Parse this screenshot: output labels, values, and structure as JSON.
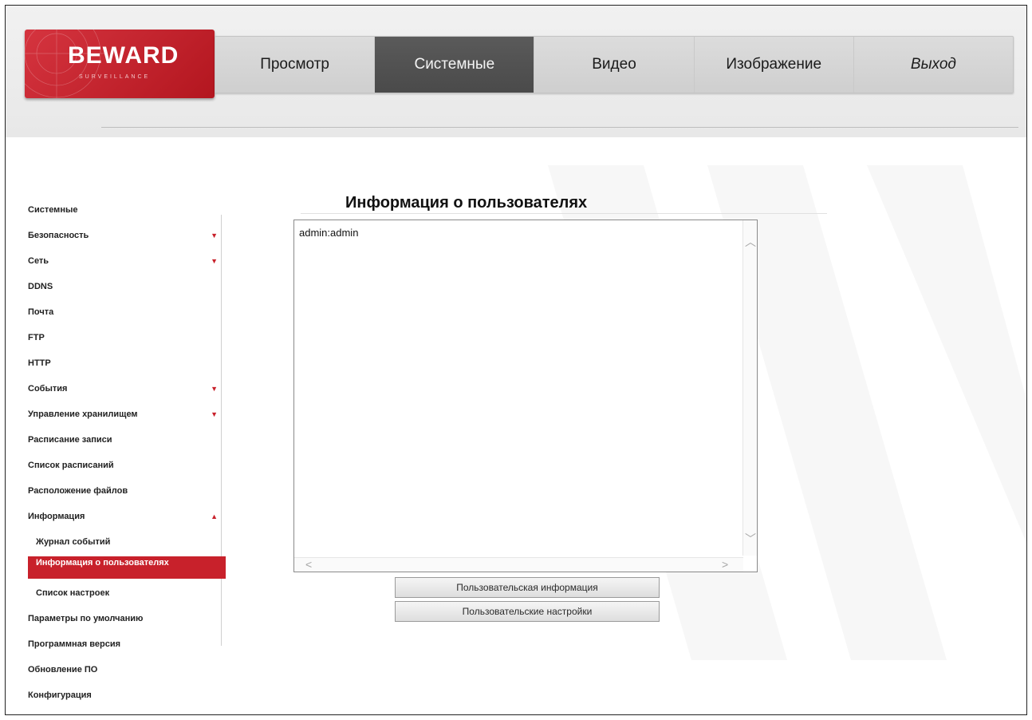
{
  "logo": {
    "brand": "BEWARD",
    "sub": "SURVEILLANCE"
  },
  "nav": [
    {
      "label": "Просмотр",
      "active": false,
      "italic": false
    },
    {
      "label": "Системные",
      "active": true,
      "italic": false
    },
    {
      "label": "Видео",
      "active": false,
      "italic": false
    },
    {
      "label": "Изображение",
      "active": false,
      "italic": false
    },
    {
      "label": "Выход",
      "active": false,
      "italic": true
    }
  ],
  "sidebar": [
    {
      "label": "Системные",
      "arrow": ""
    },
    {
      "label": "Безопасность",
      "arrow": "▼"
    },
    {
      "label": "Сеть",
      "arrow": "▼"
    },
    {
      "label": "DDNS",
      "arrow": ""
    },
    {
      "label": "Почта",
      "arrow": ""
    },
    {
      "label": "FTP",
      "arrow": ""
    },
    {
      "label": "HTTP",
      "arrow": ""
    },
    {
      "label": "События",
      "arrow": "▼"
    },
    {
      "label": "Управление хранилищем",
      "arrow": "▼"
    },
    {
      "label": "Расписание записи",
      "arrow": ""
    },
    {
      "label": "Список расписаний",
      "arrow": ""
    },
    {
      "label": "Расположение файлов",
      "arrow": ""
    },
    {
      "label": "Информация",
      "arrow": "▲"
    },
    {
      "label": "Журнал событий",
      "arrow": "",
      "sub": true
    },
    {
      "label": "Информация о пользователях",
      "arrow": "",
      "sub": true,
      "active": true
    },
    {
      "label": "Список настроек",
      "arrow": "",
      "sub": true
    },
    {
      "label": "Параметры по умолчанию",
      "arrow": ""
    },
    {
      "label": "Программная версия",
      "arrow": ""
    },
    {
      "label": "Обновление ПО",
      "arrow": ""
    },
    {
      "label": "Конфигурация",
      "arrow": ""
    }
  ],
  "main": {
    "title": "Информация о пользователях",
    "users_text": "admin:admin",
    "buttons": {
      "user_info": "Пользовательская информация",
      "user_settings": "Пользовательские настройки"
    }
  },
  "icons": {
    "scroll_up": "chevron-up-icon",
    "scroll_down": "chevron-down-icon",
    "scroll_left": "chevron-left-icon",
    "scroll_right": "chevron-right-icon"
  },
  "colors": {
    "accent": "#c8212b",
    "active_tab": "#4f4f4f"
  }
}
